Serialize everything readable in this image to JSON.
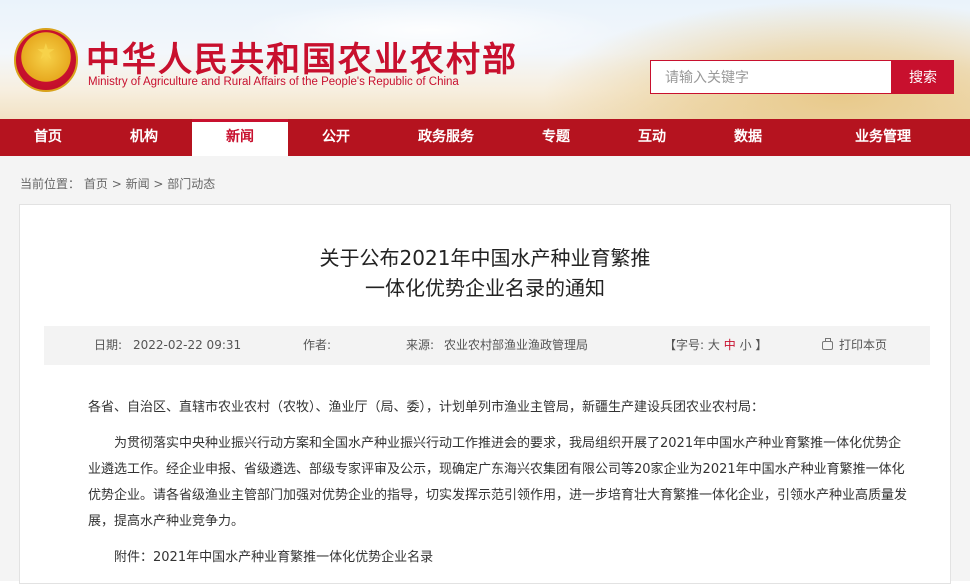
{
  "header": {
    "title_cn": "中华人民共和国农业农村部",
    "title_en": "Ministry of Agriculture and Rural Affairs of the People's Republic of China",
    "search_placeholder": "请输入关键字",
    "search_button": "搜索"
  },
  "nav": {
    "items": [
      {
        "label": "首页",
        "width": 0
      },
      {
        "label": "机构"
      },
      {
        "label": "新闻",
        "active": true
      },
      {
        "label": "公开"
      },
      {
        "label": "政务服务"
      },
      {
        "label": "专题"
      },
      {
        "label": "互动"
      },
      {
        "label": "数据"
      },
      {
        "label": "业务管理"
      }
    ]
  },
  "breadcrumb": {
    "prefix": "当前位置：",
    "home": "首页",
    "sep": " > ",
    "level2": "新闻",
    "level3": "部门动态"
  },
  "article": {
    "title_line1": "关于公布2021年中国水产种业育繁推",
    "title_line2": "一体化优势企业名录的通知",
    "meta": {
      "date_label": "日期:",
      "date_value": "2022-02-22 09:31",
      "author_label": "作者:",
      "source_label": "来源:",
      "source_value": "农业农村部渔业渔政管理局",
      "font_size_open": "【字号:",
      "font_large": "大",
      "font_medium": "中",
      "font_small": "小",
      "font_size_close": "】",
      "print": "打印本页"
    },
    "salutation": "各省、自治区、直辖市农业农村（农牧）、渔业厅（局、委），计划单列市渔业主管局，新疆生产建设兵团农业农村局：",
    "paragraph1": "为贯彻落实中央种业振兴行动方案和全国水产种业振兴行动工作推进会的要求，我局组织开展了2021年中国水产种业育繁推一体化优势企业遴选工作。经企业申报、省级遴选、部级专家评审及公示，现确定广东海兴农集团有限公司等20家企业为2021年中国水产种业育繁推一体化优势企业。请各省级渔业主管部门加强对优势企业的指导，切实发挥示范引领作用，进一步培育壮大育繁推一体化企业，引领水产种业高质量发展，提高水产种业竞争力。",
    "attachment": "附件：2021年中国水产种业育繁推一体化优势企业名录"
  },
  "colors": {
    "brand_red": "#c8102e",
    "nav_red": "#b5131f"
  }
}
